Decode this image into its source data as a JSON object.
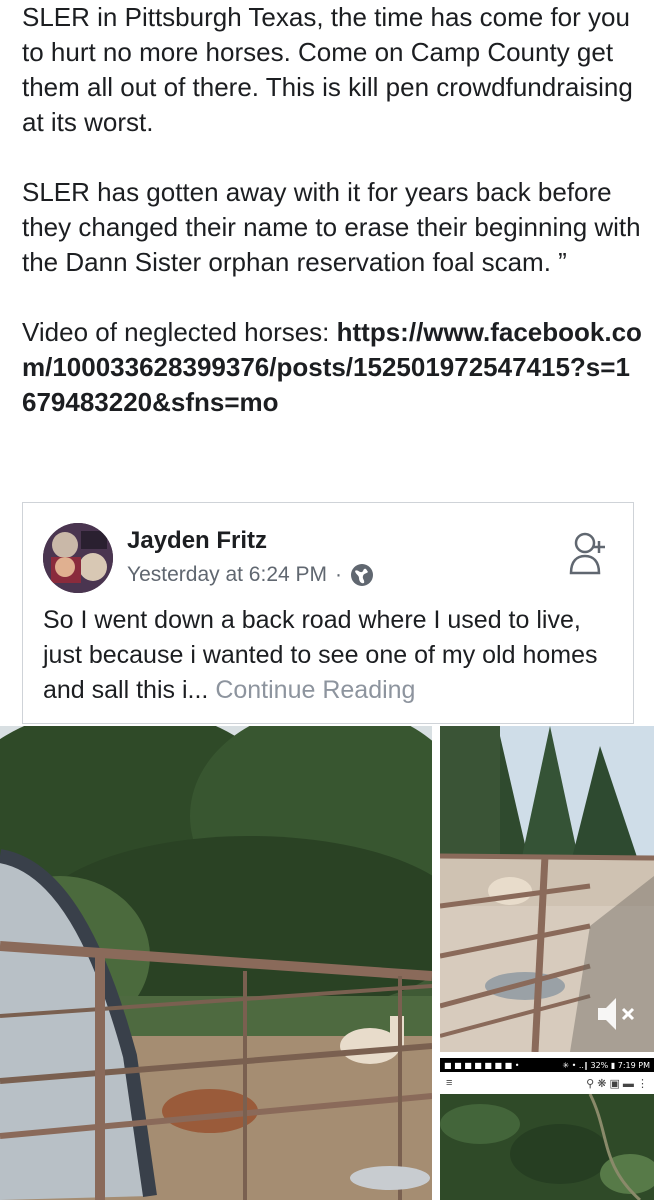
{
  "post": {
    "paragraph1": "SLER in Pittsburgh Texas, the time has come for you to hurt no more horses. Come on Camp County get them all out of there. This is kill pen crowdfundraising at its worst.",
    "paragraph2": "SLER has gotten away with it for years back before they changed their name to erase their beginning with the Dann Sister orphan reservation foal scam. ”",
    "video_prefix": "Video of neglected horses: ",
    "video_link": "https://www.facebook.com/100033628399376/posts/152501972547415?s=1679483220&sfns=mo"
  },
  "shared_post": {
    "author": "Jayden Fritz",
    "timestamp": "Yesterday at 6:24 PM",
    "separator": "·",
    "icon_globe": "globe-icon",
    "icon_add_friend": "add-friend-icon",
    "body": "So I went down a back road where I used to live, just because i wanted to see one of my old homes and sall this i... ",
    "continue_label": "Continue Reading"
  },
  "photos": {
    "mute_icon": "speaker-mute-icon",
    "map_status_left": "■ ■ ■ ■ ■ ■ ■ •",
    "map_status_right": "✳ • ..∥ 32% ▮ 7:19 PM"
  },
  "colors": {
    "text": "#1c1e21",
    "secondary": "#606770",
    "muted": "#8d949e",
    "border": "#cfd3d8"
  }
}
